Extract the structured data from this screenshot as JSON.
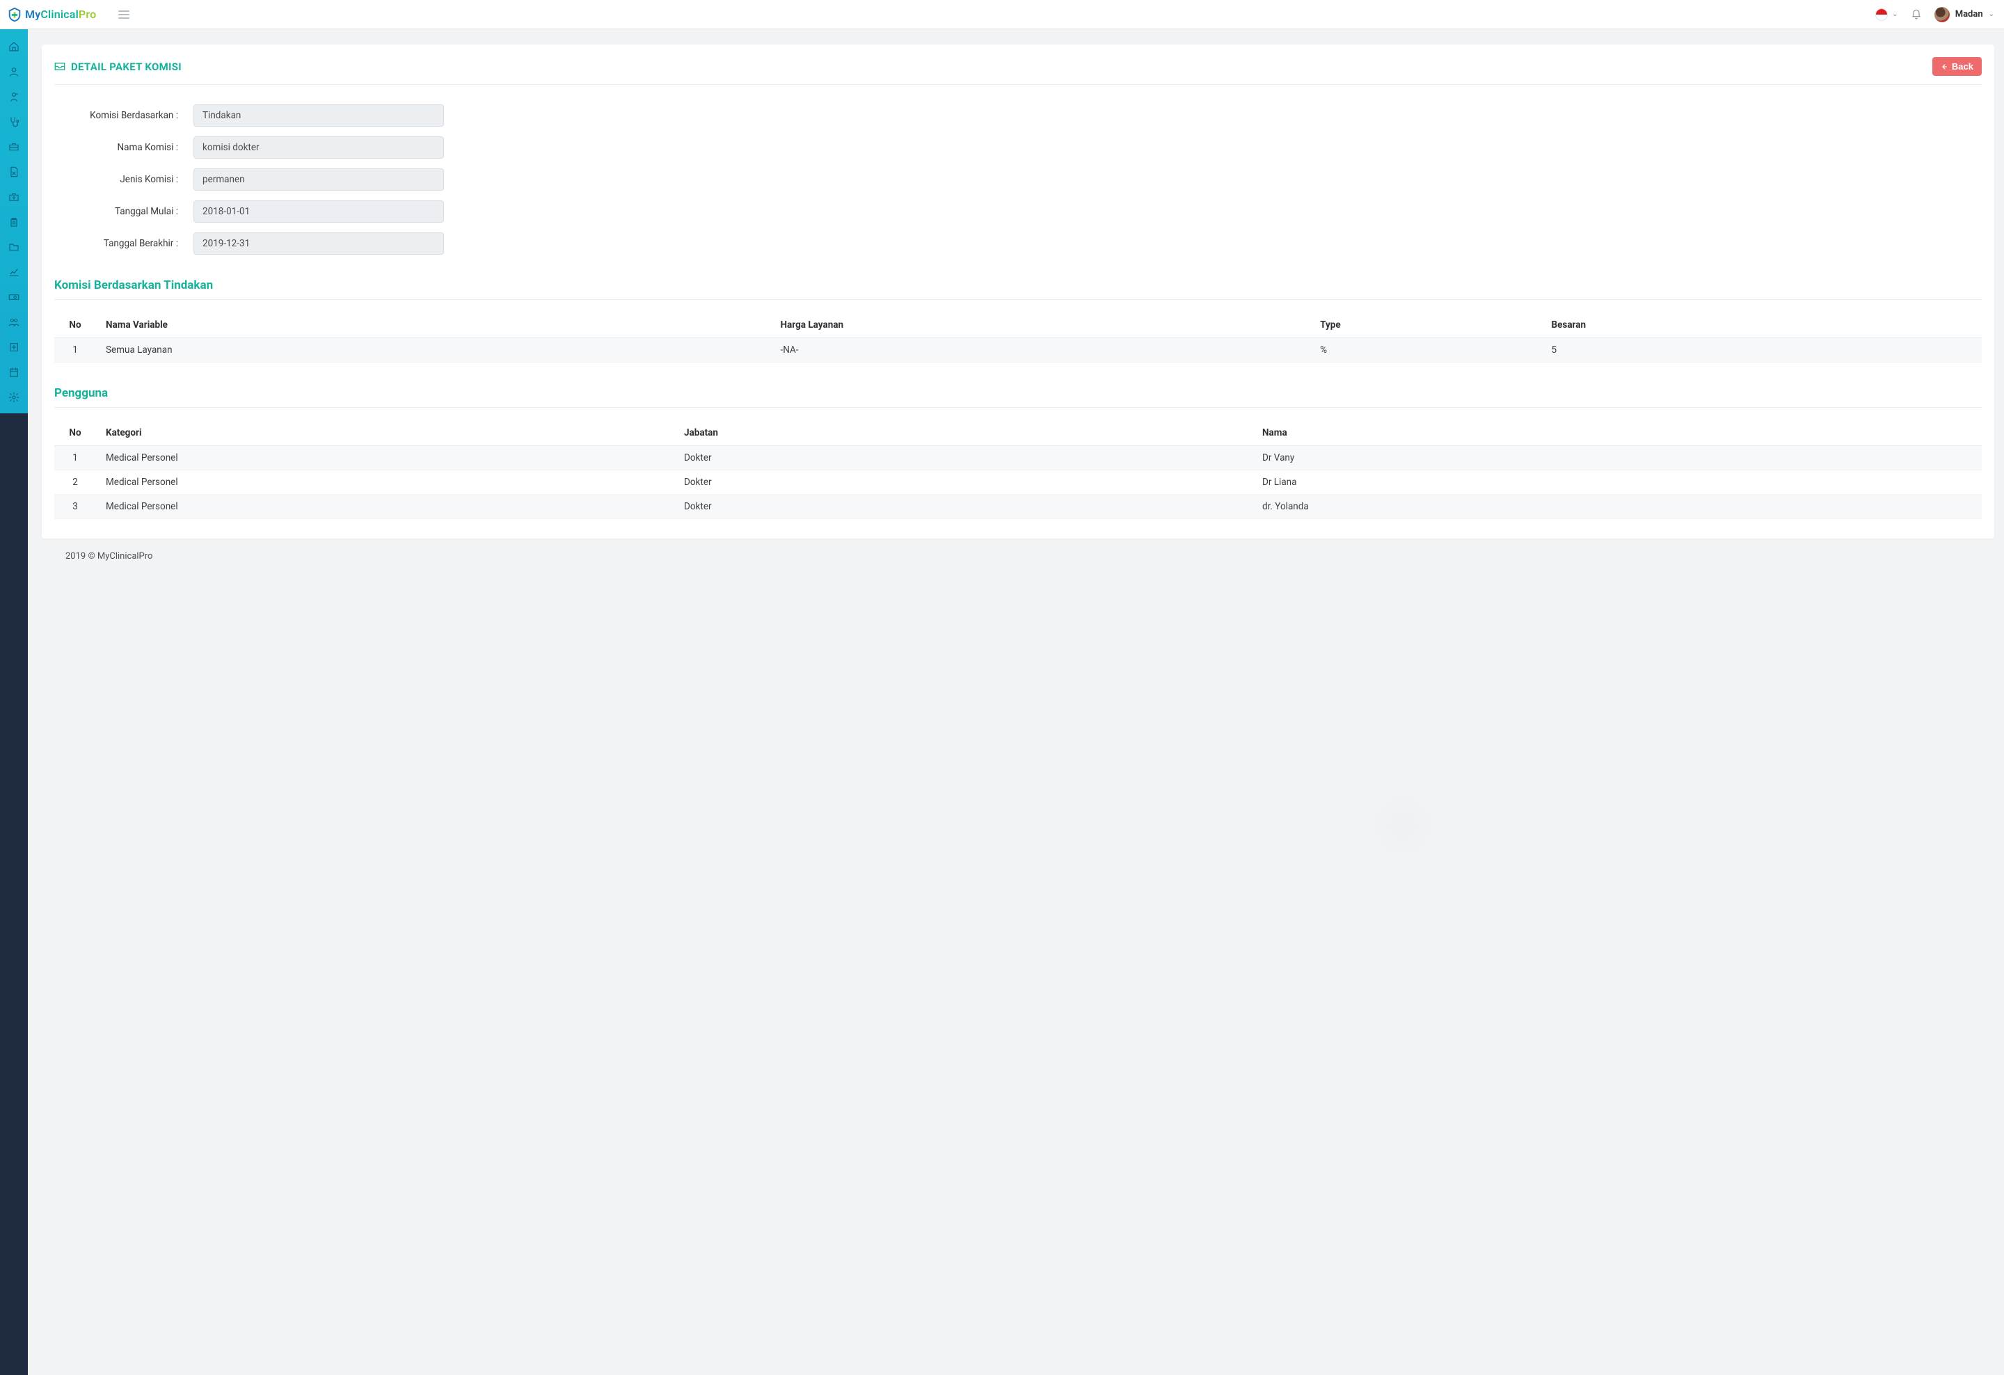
{
  "app": {
    "logo_my": "My",
    "logo_clinical": "Clinical",
    "logo_pro": "Pro"
  },
  "header": {
    "user_name": "Madan"
  },
  "sidebar": {
    "items": [
      "home",
      "user",
      "patient",
      "stethoscope",
      "briefcase",
      "file-x",
      "medkit",
      "clipboard",
      "folder",
      "chart-line",
      "cash",
      "people",
      "plus-box",
      "calendar",
      "gear"
    ]
  },
  "page": {
    "title": "DETAIL PAKET KOMISI",
    "back_label": "Back"
  },
  "form": {
    "rows": [
      {
        "label": "Komisi Berdasarkan :",
        "value": "Tindakan"
      },
      {
        "label": "Nama Komisi :",
        "value": "komisi dokter"
      },
      {
        "label": "Jenis Komisi :",
        "value": "permanen"
      },
      {
        "label": "Tanggal Mulai :",
        "value": "2018-01-01"
      },
      {
        "label": "Tanggal Berakhir :",
        "value": "2019-12-31"
      }
    ]
  },
  "section1": {
    "title": "Komisi Berdasarkan Tindakan",
    "columns": {
      "no": "No",
      "nama": "Nama Variable",
      "harga": "Harga Layanan",
      "type": "Type",
      "besaran": "Besaran"
    },
    "rows": [
      {
        "no": "1",
        "nama": "Semua Layanan",
        "harga": "-NA-",
        "type": "%",
        "besaran": "5"
      }
    ]
  },
  "section2": {
    "title": "Pengguna",
    "columns": {
      "no": "No",
      "kategori": "Kategori",
      "jabatan": "Jabatan",
      "nama": "Nama"
    },
    "rows": [
      {
        "no": "1",
        "kategori": "Medical Personel",
        "jabatan": "Dokter",
        "nama": "Dr Vany"
      },
      {
        "no": "2",
        "kategori": "Medical Personel",
        "jabatan": "Dokter",
        "nama": "Dr Liana"
      },
      {
        "no": "3",
        "kategori": "Medical Personel",
        "jabatan": "Dokter",
        "nama": "dr. Yolanda"
      }
    ]
  },
  "footer": {
    "text": "2019 © MyClinicalPro"
  }
}
